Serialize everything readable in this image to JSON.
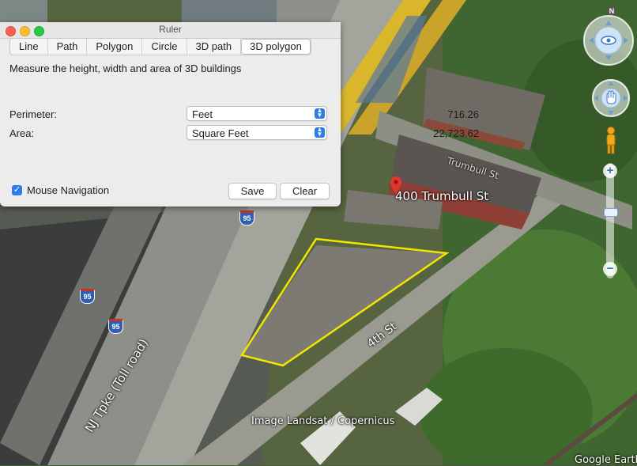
{
  "window": {
    "title": "Ruler"
  },
  "tabs": [
    {
      "label": "Line",
      "active": false
    },
    {
      "label": "Path",
      "active": false
    },
    {
      "label": "Polygon",
      "active": false
    },
    {
      "label": "Circle",
      "active": false
    },
    {
      "label": "3D path",
      "active": false
    },
    {
      "label": "3D polygon",
      "active": true
    }
  ],
  "panel": {
    "description": "Measure the height, width and area of 3D buildings",
    "perimeter": {
      "label": "Perimeter:",
      "value": "716.26",
      "unit": "Feet"
    },
    "area": {
      "label": "Area:",
      "value": "22,723.62",
      "unit": "Square Feet"
    },
    "mouse_navigation": {
      "label": "Mouse Navigation",
      "checked": true
    },
    "save_label": "Save",
    "clear_label": "Clear"
  },
  "map": {
    "placemark_label": "400 Trumbull St",
    "road_labels": {
      "trumbull": "Trumbull St",
      "fourth": "4th St",
      "nj_tpke": "NJ Tpke (Toll road)"
    },
    "shields": [
      "95",
      "95",
      "95"
    ],
    "attribution": "Image Landsat / Copernicus",
    "brand": "Google Earth",
    "compass_north": "N"
  },
  "controls": {
    "zoom_in": "+",
    "zoom_out": "−",
    "zoom_level": 0.38
  },
  "colors": {
    "accent": "#2d7de8",
    "polygon": "#f2e600",
    "placemark": "#e0382c",
    "shield": "#2f5fb0"
  }
}
